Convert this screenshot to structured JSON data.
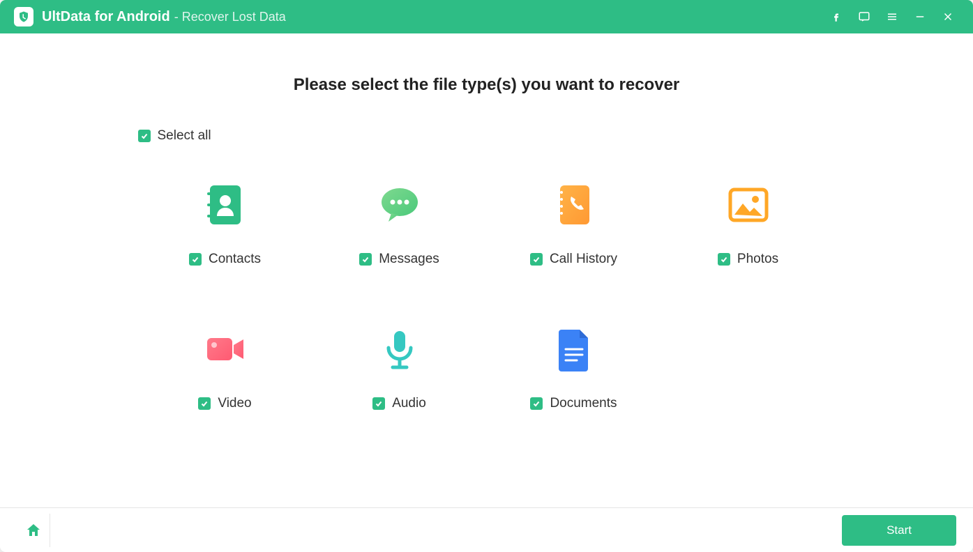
{
  "titlebar": {
    "app_name": "UltData for Android",
    "subtitle": "- Recover Lost Data"
  },
  "heading": "Please select the file type(s) you want to recover",
  "select_all": {
    "label": "Select all",
    "checked": true
  },
  "file_types": [
    {
      "id": "contacts",
      "label": "Contacts",
      "checked": true
    },
    {
      "id": "messages",
      "label": "Messages",
      "checked": true
    },
    {
      "id": "call-history",
      "label": "Call History",
      "checked": true
    },
    {
      "id": "photos",
      "label": "Photos",
      "checked": true
    },
    {
      "id": "video",
      "label": "Video",
      "checked": true
    },
    {
      "id": "audio",
      "label": "Audio",
      "checked": true
    },
    {
      "id": "documents",
      "label": "Documents",
      "checked": true
    }
  ],
  "footer": {
    "start_label": "Start"
  }
}
